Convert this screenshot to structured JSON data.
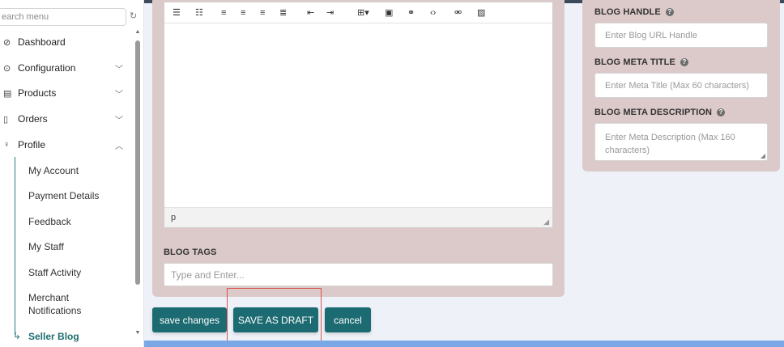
{
  "sidebar": {
    "search_placeholder": "earch menu",
    "items": [
      {
        "label": "Dashboard",
        "icon": "dashboard-icon"
      },
      {
        "label": "Configuration",
        "icon": "configuration-icon"
      },
      {
        "label": "Products",
        "icon": "products-icon"
      },
      {
        "label": "Orders",
        "icon": "orders-icon"
      },
      {
        "label": "Profile",
        "icon": "profile-icon"
      }
    ],
    "profile_subitems": [
      "My Account",
      "Payment Details",
      "Feedback",
      "My Staff",
      "Staff Activity",
      "Merchant Notifications",
      "Seller Blog"
    ]
  },
  "editor": {
    "path": "p"
  },
  "blog_tags": {
    "label": "BLOG TAGS",
    "placeholder": "Type and Enter..."
  },
  "actions": {
    "save_changes": "save changes",
    "save_as_draft": "SAVE AS DRAFT",
    "cancel": "cancel"
  },
  "side": {
    "handle_label": "BLOG HANDLE",
    "handle_placeholder": "Enter Blog URL Handle",
    "meta_title_label": "BLOG META TITLE",
    "meta_title_placeholder": "Enter Meta Title (Max 60 characters)",
    "meta_desc_label": "BLOG META DESCRIPTION",
    "meta_desc_placeholder": "Enter Meta Description (Max 160 characters)"
  },
  "colors": {
    "accent": "#1d6b72",
    "card": "#dcc9c9",
    "highlight": "#d9534f"
  }
}
